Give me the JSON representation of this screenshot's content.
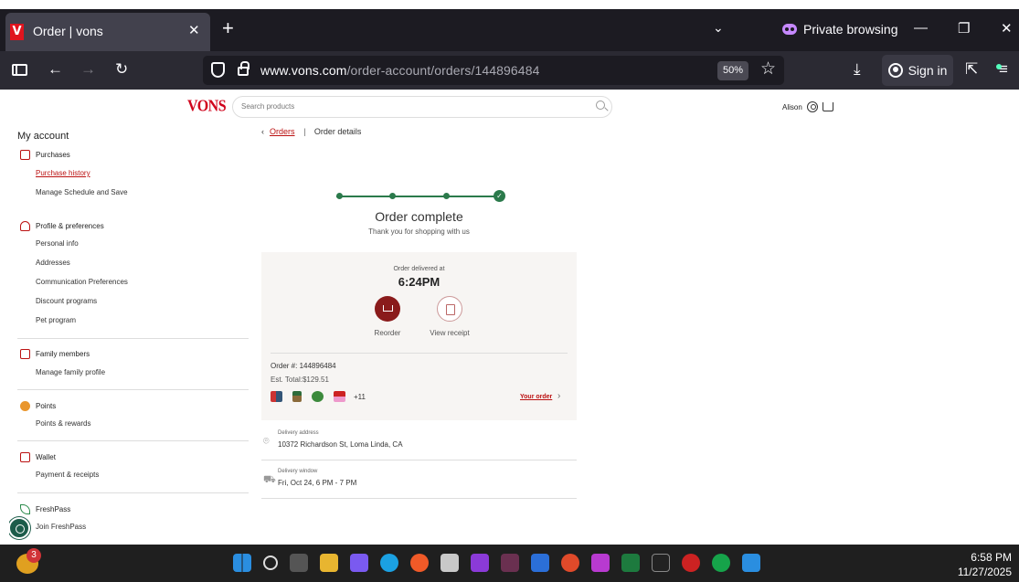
{
  "browser": {
    "tab_title": "Order | vons",
    "favicon_letter": "V",
    "private_label": "Private browsing",
    "url_domain": "www.vons.com",
    "url_path": "/order-account/orders/144896484",
    "zoom": "50%",
    "sign_in": "Sign in"
  },
  "site": {
    "logo": "VONS",
    "search_placeholder": "Search products",
    "user_name": "Alison"
  },
  "account_nav": {
    "title": "My account",
    "sections": [
      {
        "label": "Purchases",
        "items": [
          "Purchase history",
          "Manage Schedule and Save"
        ]
      },
      {
        "label": "Profile & preferences",
        "items": [
          "Personal info",
          "Addresses",
          "Communication Preferences",
          "Discount programs",
          "Pet program"
        ]
      },
      {
        "label": "Family members",
        "items": [
          "Manage family profile"
        ]
      },
      {
        "label": "Points",
        "items": [
          "Points & rewards"
        ]
      },
      {
        "label": "Wallet",
        "items": [
          "Payment & receipts"
        ]
      },
      {
        "label": "FreshPass",
        "items": [
          "Join FreshPass"
        ]
      }
    ]
  },
  "breadcrumb": {
    "back": "Orders",
    "current": "Order details"
  },
  "order": {
    "status_title": "Order complete",
    "status_subtitle": "Thank you for shopping with us",
    "delivered_label": "Order delivered at",
    "delivered_time": "6:24PM",
    "reorder_label": "Reorder",
    "receipt_label": "View receipt",
    "order_number": "Order #: 144896484",
    "est_total": "Est. Total:$129.51",
    "more_items": "+11",
    "your_order": "Your order",
    "delivery_address_label": "Delivery address",
    "delivery_address": "10372 Richardson St, Loma Linda, CA",
    "delivery_window_label": "Delivery window",
    "delivery_window": "Fri, Oct 24, 6 PM - 7 PM"
  },
  "taskbar": {
    "weather_badge": "3",
    "time": "6:58 PM",
    "date": "11/27/2025"
  }
}
